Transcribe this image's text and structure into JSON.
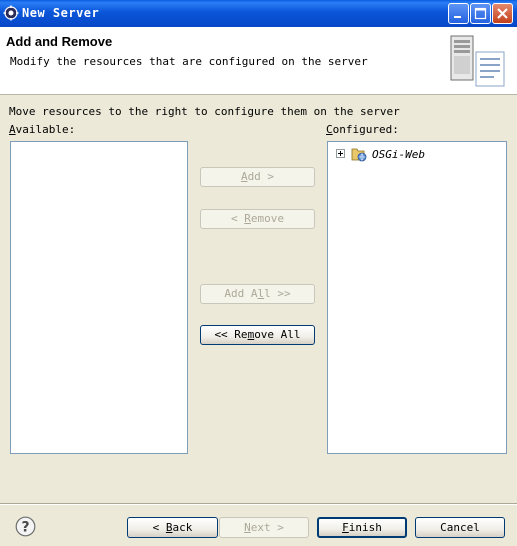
{
  "window": {
    "title": "New Server",
    "colors": {
      "titlebar": "#0a55d8",
      "dialog_bg": "#ece9d8"
    }
  },
  "header": {
    "title": "Add and Remove",
    "description": "Modify the resources that are configured on the server"
  },
  "instructions": "Move resources to the right to configure them on the server",
  "available": {
    "label_mnemonic": "A",
    "label_rest": "vailable:",
    "items": []
  },
  "configured": {
    "label_mnemonic": "C",
    "label_rest": "onfigured:",
    "items": [
      {
        "label": "OSGi-Web",
        "icon": "project-icon",
        "expandable": true
      }
    ]
  },
  "buttons": {
    "add": {
      "pre": "",
      "mnemonic": "A",
      "post": "dd >",
      "enabled": false
    },
    "remove": {
      "pre": "< ",
      "mnemonic": "R",
      "post": "emove",
      "enabled": false
    },
    "add_all": {
      "pre": "Add A",
      "mnemonic": "l",
      "post": "l >>",
      "enabled": false
    },
    "remove_all": {
      "pre": "<< Re",
      "mnemonic": "m",
      "post": "ove All",
      "enabled": true
    }
  },
  "footer": {
    "back": {
      "pre": "< ",
      "mnemonic": "B",
      "post": "ack",
      "enabled": true
    },
    "next": {
      "pre": "",
      "mnemonic": "N",
      "post": "ext >",
      "enabled": false
    },
    "finish": {
      "pre": "",
      "mnemonic": "F",
      "post": "inish",
      "enabled": true
    },
    "cancel": {
      "label": "Cancel",
      "enabled": true
    },
    "help_icon": "help-icon"
  }
}
